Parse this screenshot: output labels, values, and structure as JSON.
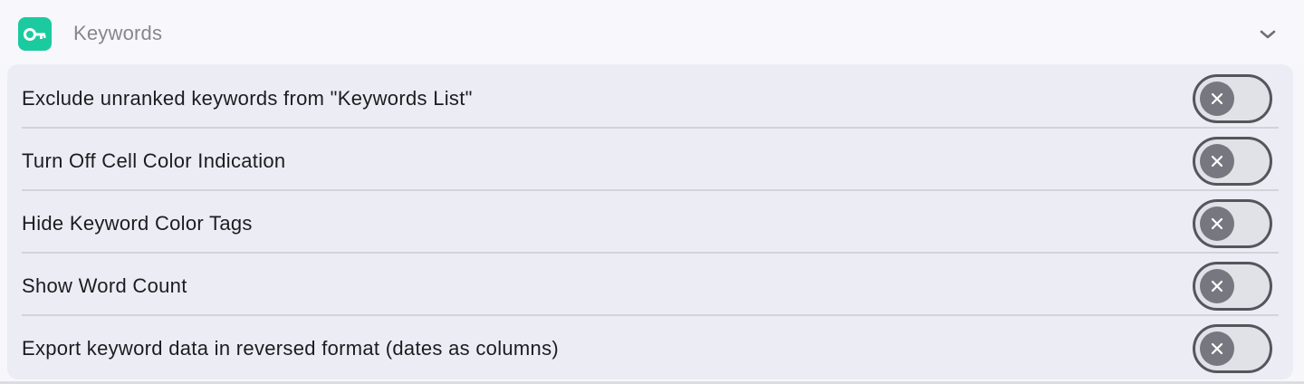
{
  "header": {
    "icon": "key-icon",
    "title": "Keywords",
    "accent_color": "#1ccaa0",
    "toggle_icon": "chevron-down-icon"
  },
  "settings": [
    {
      "label": "Exclude unranked keywords from \"Keywords List\"",
      "enabled": false,
      "name": "exclude-unranked-keywords"
    },
    {
      "label": "Turn Off Cell Color Indication",
      "enabled": false,
      "name": "turn-off-cell-color-indication"
    },
    {
      "label": "Hide Keyword Color Tags",
      "enabled": false,
      "name": "hide-keyword-color-tags"
    },
    {
      "label": "Show Word Count",
      "enabled": false,
      "name": "show-word-count"
    },
    {
      "label": "Export keyword data in reversed format (dates as columns)",
      "enabled": false,
      "name": "export-reversed-format"
    }
  ],
  "toggle_off_icon": "close-icon"
}
